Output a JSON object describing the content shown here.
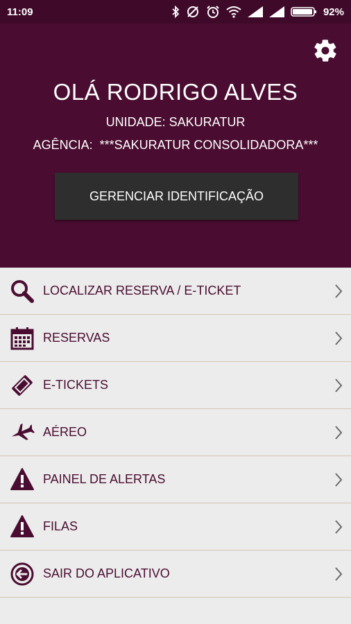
{
  "status_bar": {
    "time": "11:09",
    "battery": "92%"
  },
  "header": {
    "settings_icon": "gear-icon",
    "greeting": "OLÁ RODRIGO ALVES",
    "unit": "UNIDADE: SAKURATUR",
    "agency_label": "AGÊNCIA:",
    "agency_name": "***SAKURATUR CONSOLIDADORA***",
    "manage_button": "GERENCIAR IDENTIFICAÇÃO"
  },
  "menu": [
    {
      "label": "LOCALIZAR RESERVA / E-TICKET",
      "icon": "search-icon"
    },
    {
      "label": "RESERVAS",
      "icon": "calendar-icon"
    },
    {
      "label": "E-TICKETS",
      "icon": "ticket-icon"
    },
    {
      "label": "AÉREO",
      "icon": "airplane-icon"
    },
    {
      "label": "PAINEL DE ALERTAS",
      "icon": "warning-icon"
    },
    {
      "label": "FILAS",
      "icon": "warning-icon"
    },
    {
      "label": "SAIR DO APLICATIVO",
      "icon": "logout-icon"
    }
  ],
  "colors": {
    "primary": "#4a0d31",
    "status_bar": "#3f0a2a",
    "button": "#2e2e2e",
    "background": "#ececec",
    "divider": "#d4c3b0"
  }
}
